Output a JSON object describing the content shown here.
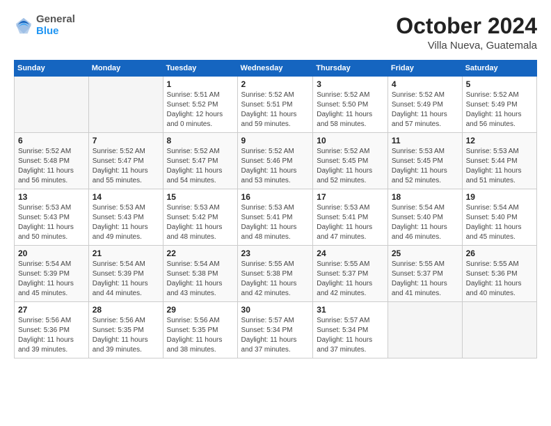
{
  "logo": {
    "general": "General",
    "blue": "Blue"
  },
  "header": {
    "month": "October 2024",
    "location": "Villa Nueva, Guatemala"
  },
  "weekdays": [
    "Sunday",
    "Monday",
    "Tuesday",
    "Wednesday",
    "Thursday",
    "Friday",
    "Saturday"
  ],
  "weeks": [
    [
      {
        "day": "",
        "info": ""
      },
      {
        "day": "",
        "info": ""
      },
      {
        "day": "1",
        "info": "Sunrise: 5:51 AM\nSunset: 5:52 PM\nDaylight: 12 hours\nand 0 minutes."
      },
      {
        "day": "2",
        "info": "Sunrise: 5:52 AM\nSunset: 5:51 PM\nDaylight: 11 hours\nand 59 minutes."
      },
      {
        "day": "3",
        "info": "Sunrise: 5:52 AM\nSunset: 5:50 PM\nDaylight: 11 hours\nand 58 minutes."
      },
      {
        "day": "4",
        "info": "Sunrise: 5:52 AM\nSunset: 5:49 PM\nDaylight: 11 hours\nand 57 minutes."
      },
      {
        "day": "5",
        "info": "Sunrise: 5:52 AM\nSunset: 5:49 PM\nDaylight: 11 hours\nand 56 minutes."
      }
    ],
    [
      {
        "day": "6",
        "info": "Sunrise: 5:52 AM\nSunset: 5:48 PM\nDaylight: 11 hours\nand 56 minutes."
      },
      {
        "day": "7",
        "info": "Sunrise: 5:52 AM\nSunset: 5:47 PM\nDaylight: 11 hours\nand 55 minutes."
      },
      {
        "day": "8",
        "info": "Sunrise: 5:52 AM\nSunset: 5:47 PM\nDaylight: 11 hours\nand 54 minutes."
      },
      {
        "day": "9",
        "info": "Sunrise: 5:52 AM\nSunset: 5:46 PM\nDaylight: 11 hours\nand 53 minutes."
      },
      {
        "day": "10",
        "info": "Sunrise: 5:52 AM\nSunset: 5:45 PM\nDaylight: 11 hours\nand 52 minutes."
      },
      {
        "day": "11",
        "info": "Sunrise: 5:53 AM\nSunset: 5:45 PM\nDaylight: 11 hours\nand 52 minutes."
      },
      {
        "day": "12",
        "info": "Sunrise: 5:53 AM\nSunset: 5:44 PM\nDaylight: 11 hours\nand 51 minutes."
      }
    ],
    [
      {
        "day": "13",
        "info": "Sunrise: 5:53 AM\nSunset: 5:43 PM\nDaylight: 11 hours\nand 50 minutes."
      },
      {
        "day": "14",
        "info": "Sunrise: 5:53 AM\nSunset: 5:43 PM\nDaylight: 11 hours\nand 49 minutes."
      },
      {
        "day": "15",
        "info": "Sunrise: 5:53 AM\nSunset: 5:42 PM\nDaylight: 11 hours\nand 48 minutes."
      },
      {
        "day": "16",
        "info": "Sunrise: 5:53 AM\nSunset: 5:41 PM\nDaylight: 11 hours\nand 48 minutes."
      },
      {
        "day": "17",
        "info": "Sunrise: 5:53 AM\nSunset: 5:41 PM\nDaylight: 11 hours\nand 47 minutes."
      },
      {
        "day": "18",
        "info": "Sunrise: 5:54 AM\nSunset: 5:40 PM\nDaylight: 11 hours\nand 46 minutes."
      },
      {
        "day": "19",
        "info": "Sunrise: 5:54 AM\nSunset: 5:40 PM\nDaylight: 11 hours\nand 45 minutes."
      }
    ],
    [
      {
        "day": "20",
        "info": "Sunrise: 5:54 AM\nSunset: 5:39 PM\nDaylight: 11 hours\nand 45 minutes."
      },
      {
        "day": "21",
        "info": "Sunrise: 5:54 AM\nSunset: 5:39 PM\nDaylight: 11 hours\nand 44 minutes."
      },
      {
        "day": "22",
        "info": "Sunrise: 5:54 AM\nSunset: 5:38 PM\nDaylight: 11 hours\nand 43 minutes."
      },
      {
        "day": "23",
        "info": "Sunrise: 5:55 AM\nSunset: 5:38 PM\nDaylight: 11 hours\nand 42 minutes."
      },
      {
        "day": "24",
        "info": "Sunrise: 5:55 AM\nSunset: 5:37 PM\nDaylight: 11 hours\nand 42 minutes."
      },
      {
        "day": "25",
        "info": "Sunrise: 5:55 AM\nSunset: 5:37 PM\nDaylight: 11 hours\nand 41 minutes."
      },
      {
        "day": "26",
        "info": "Sunrise: 5:55 AM\nSunset: 5:36 PM\nDaylight: 11 hours\nand 40 minutes."
      }
    ],
    [
      {
        "day": "27",
        "info": "Sunrise: 5:56 AM\nSunset: 5:36 PM\nDaylight: 11 hours\nand 39 minutes."
      },
      {
        "day": "28",
        "info": "Sunrise: 5:56 AM\nSunset: 5:35 PM\nDaylight: 11 hours\nand 39 minutes."
      },
      {
        "day": "29",
        "info": "Sunrise: 5:56 AM\nSunset: 5:35 PM\nDaylight: 11 hours\nand 38 minutes."
      },
      {
        "day": "30",
        "info": "Sunrise: 5:57 AM\nSunset: 5:34 PM\nDaylight: 11 hours\nand 37 minutes."
      },
      {
        "day": "31",
        "info": "Sunrise: 5:57 AM\nSunset: 5:34 PM\nDaylight: 11 hours\nand 37 minutes."
      },
      {
        "day": "",
        "info": ""
      },
      {
        "day": "",
        "info": ""
      }
    ]
  ]
}
